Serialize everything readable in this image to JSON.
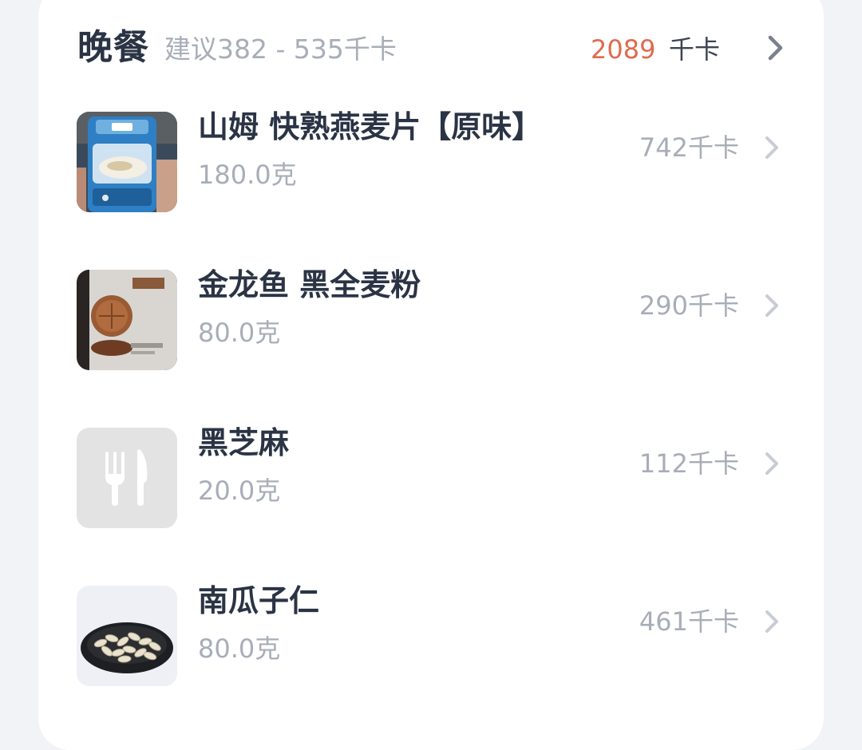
{
  "meal": {
    "title": "晚餐",
    "suggestion": "建议382 - 535千卡",
    "total_kcal": "2089",
    "total_unit": "千卡"
  },
  "items": [
    {
      "name": "山姆 快熟燕麦片【原味】",
      "amount": "180.0克",
      "kcal": "742千卡",
      "thumbnail": "oat-jar-photo"
    },
    {
      "name": "金龙鱼 黑全麦粉",
      "amount": "80.0克",
      "kcal": "290千卡",
      "thumbnail": "flour-bag-photo"
    },
    {
      "name": "黑芝麻",
      "amount": "20.0克",
      "kcal": "112千卡",
      "thumbnail": "fork-knife-placeholder-icon"
    },
    {
      "name": "南瓜子仁",
      "amount": "80.0克",
      "kcal": "461千卡",
      "thumbnail": "pumpkin-seeds-photo"
    }
  ],
  "colors": {
    "accent_total": "#e06a4e",
    "title_text": "#2b3445",
    "secondary_text": "#a8adb8",
    "card_bg": "#ffffff",
    "page_bg": "#f2f3f7"
  }
}
